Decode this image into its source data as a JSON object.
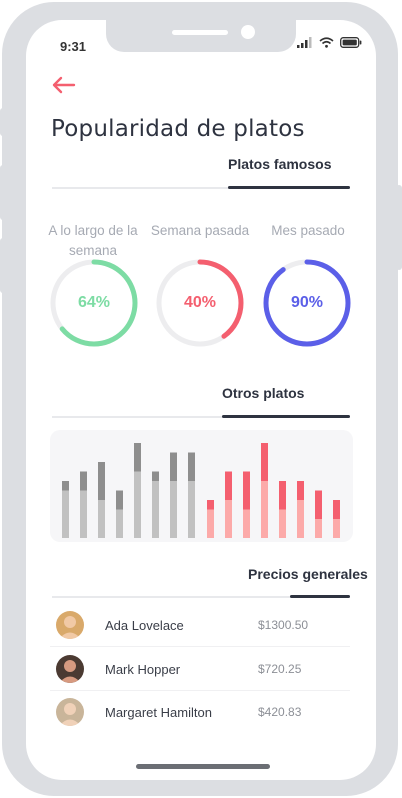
{
  "status_bar": {
    "time": "9:31"
  },
  "header": {
    "title": "Popularidad de platos"
  },
  "sections": {
    "famous": "Platos famosos",
    "others": "Otros platos",
    "prices": "Precios generales"
  },
  "gauges": [
    {
      "label": "A lo largo de la semana",
      "value_text": "64%",
      "fraction": 0.64,
      "color": "#7ddca4"
    },
    {
      "label": "Semana pasada",
      "value_text": "40%",
      "fraction": 0.4,
      "color": "#f45f6f"
    },
    {
      "label": "Mes pasado",
      "value_text": "90%",
      "fraction": 0.9,
      "color": "#5b5fe8"
    }
  ],
  "chart_data": {
    "type": "bar",
    "stacked": true,
    "groups": [
      {
        "colors": [
          "#c1c1c1",
          "#8e8e8e"
        ],
        "bars": [
          [
            0.5,
            0.1
          ],
          [
            0.5,
            0.2
          ],
          [
            0.4,
            0.4
          ],
          [
            0.3,
            0.2
          ],
          [
            0.7,
            0.3
          ],
          [
            0.6,
            0.1
          ],
          [
            0.6,
            0.3
          ],
          [
            0.6,
            0.3
          ]
        ]
      },
      {
        "colors": [
          "#fcaaa9",
          "#f45f6f"
        ],
        "bars": [
          [
            0.3,
            0.1
          ],
          [
            0.4,
            0.3
          ],
          [
            0.3,
            0.4
          ],
          [
            0.6,
            0.4
          ],
          [
            0.3,
            0.3
          ],
          [
            0.4,
            0.2
          ],
          [
            0.2,
            0.3
          ],
          [
            0.2,
            0.2
          ]
        ]
      }
    ],
    "ylim": [
      0,
      1
    ]
  },
  "users": [
    {
      "name": "Ada Lovelace",
      "price": "$1300.50",
      "skin": "#f1c9a5",
      "hair": "#d9a96a"
    },
    {
      "name": "Mark Hopper",
      "price": "$720.25",
      "skin": "#d79a80",
      "hair": "#4b3a32"
    },
    {
      "name": "Margaret Hamilton",
      "price": "$420.83",
      "skin": "#f0d1b8",
      "hair": "#c9b59a"
    }
  ]
}
